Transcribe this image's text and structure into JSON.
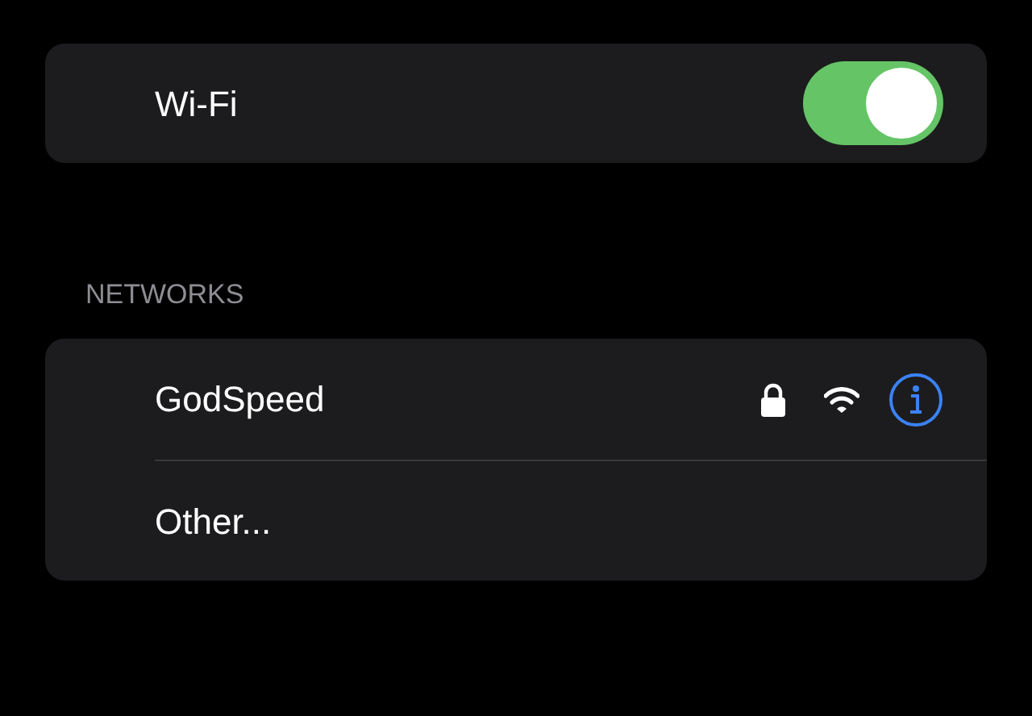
{
  "wifi": {
    "label": "Wi-Fi",
    "on": true
  },
  "section_header": "NETWORKS",
  "networks": [
    {
      "name": "GodSpeed",
      "kind": "network",
      "secured": true
    },
    {
      "name": "Other...",
      "kind": "other"
    }
  ]
}
